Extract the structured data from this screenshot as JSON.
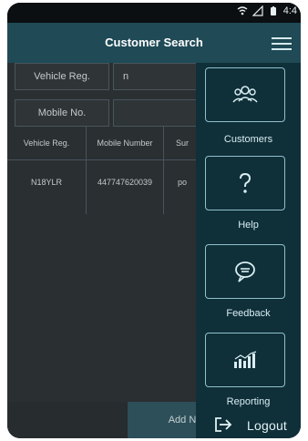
{
  "status": {
    "time": "4:4"
  },
  "header": {
    "title": "Customer Search"
  },
  "search": {
    "vehicle_reg_label": "Vehicle Reg.",
    "vehicle_reg_value": "n",
    "mobile_label": "Mobile No.",
    "mobile_value": ""
  },
  "table": {
    "headers": [
      "Vehicle Reg.",
      "Mobile Number",
      "Sur"
    ],
    "rows": [
      [
        "N18YLR",
        "447747620039",
        "po"
      ]
    ]
  },
  "bottom": {
    "add_label": "Add N"
  },
  "menu": {
    "items": [
      {
        "label": "Customers",
        "icon": "customers-icon"
      },
      {
        "label": "Help",
        "icon": "help-icon"
      },
      {
        "label": "Feedback",
        "icon": "feedback-icon"
      },
      {
        "label": "Reporting",
        "icon": "reporting-icon"
      }
    ],
    "logout_label": "Logout"
  },
  "colors": {
    "appbar": "#1f4a56",
    "drawer": "#0f2f39",
    "accent": "#8fc1cc"
  }
}
